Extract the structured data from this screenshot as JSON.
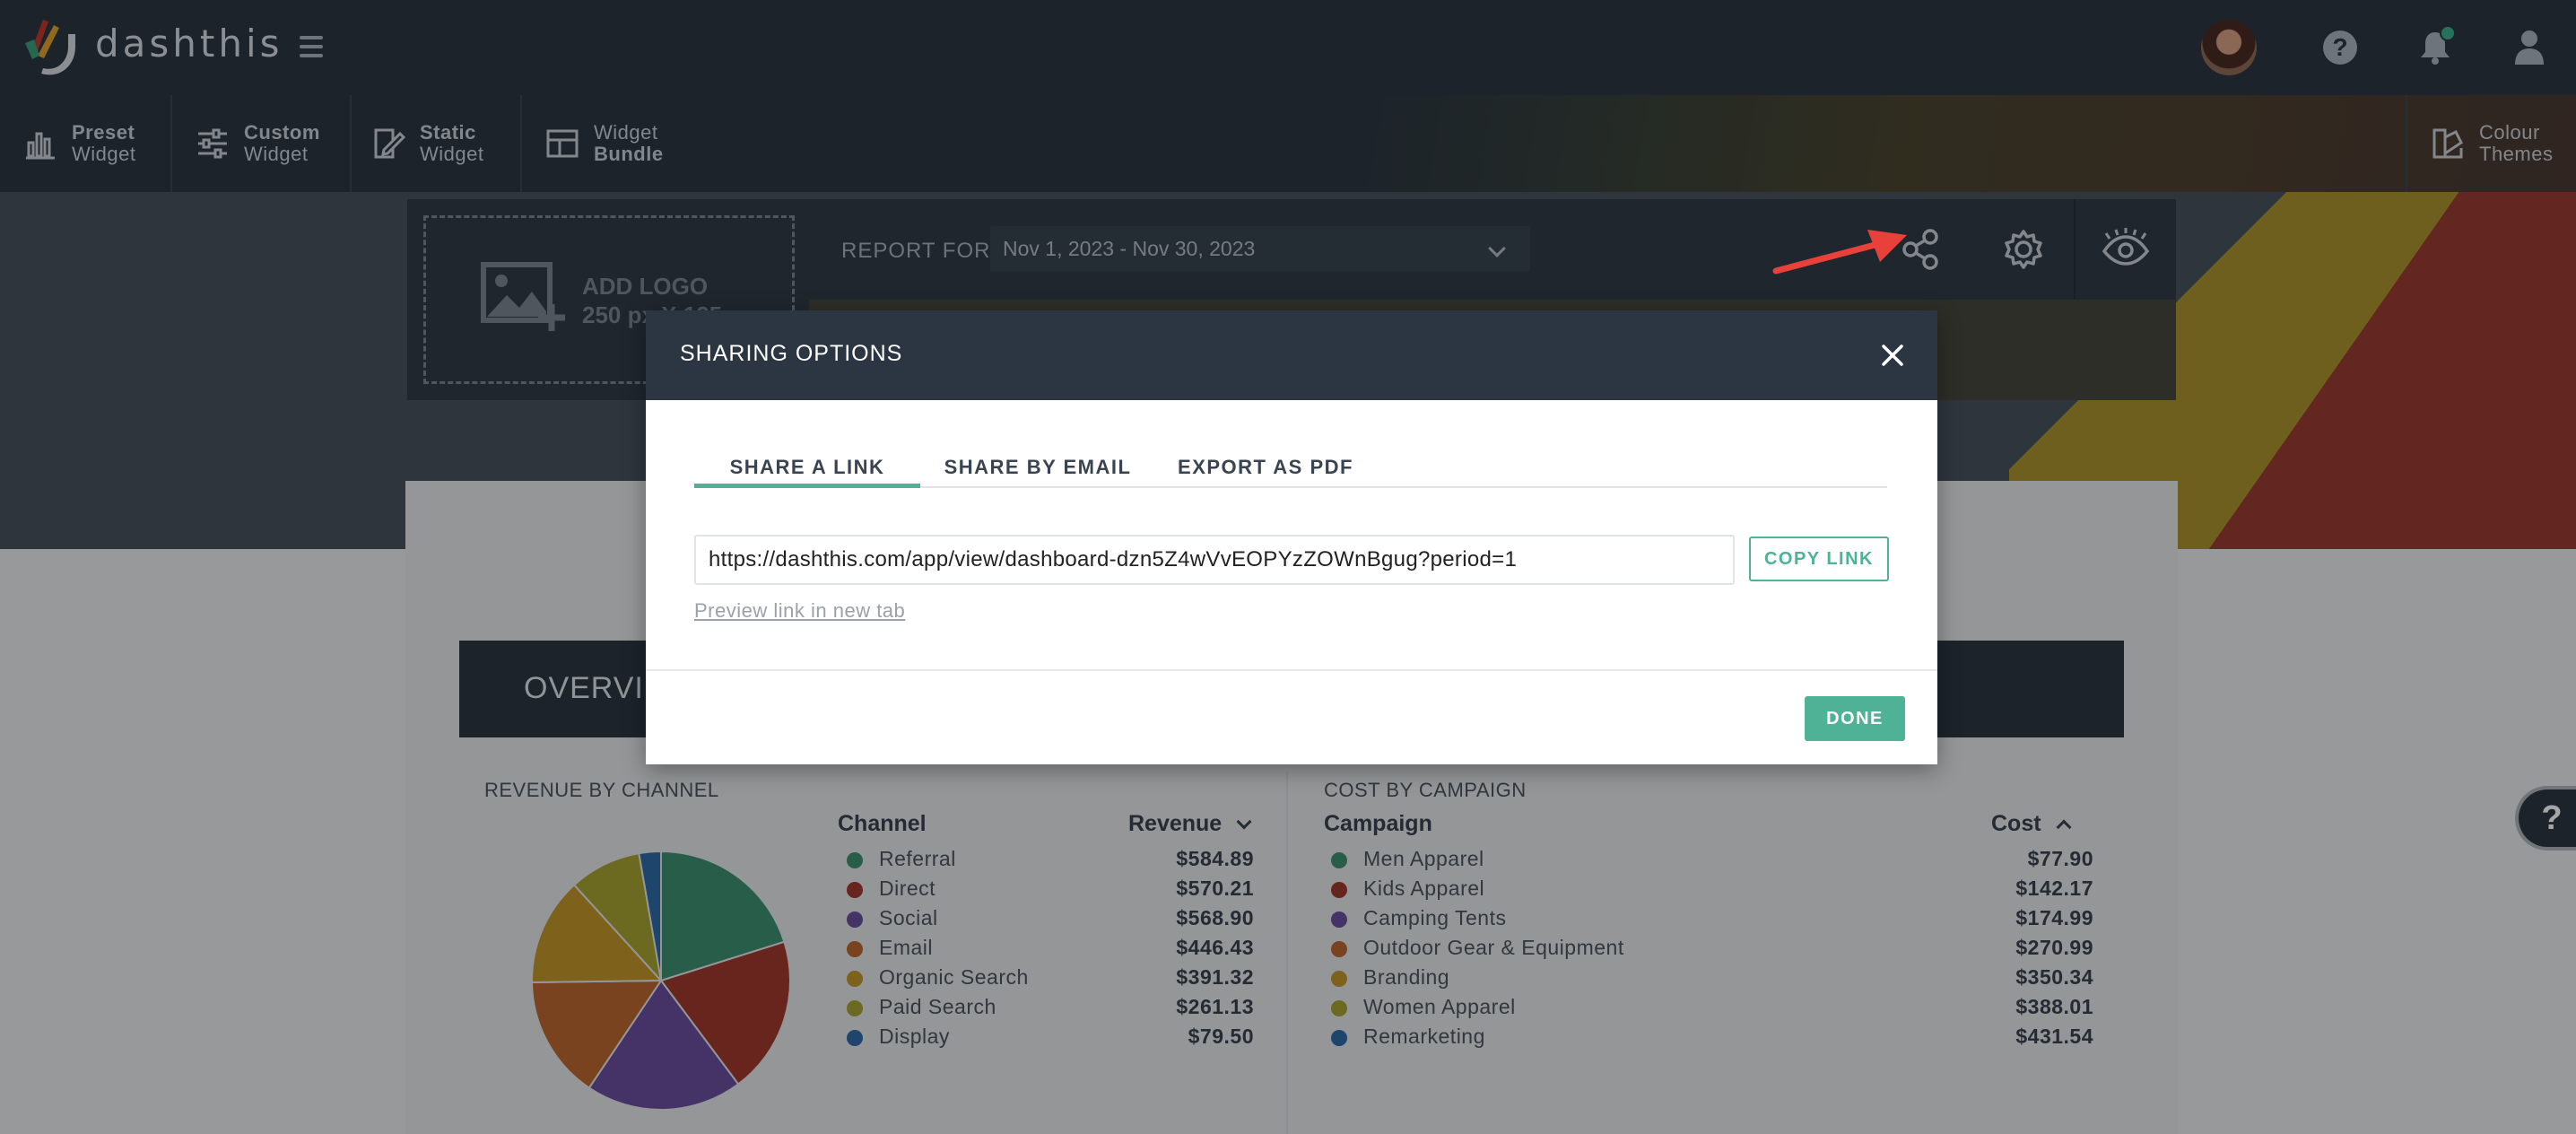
{
  "app": {
    "brand": "dashthis"
  },
  "toolbar": {
    "items": [
      {
        "line1": "Preset",
        "line2": "Widget",
        "icon": "bar-chart-icon"
      },
      {
        "line1": "Custom",
        "line2": "Widget",
        "icon": "sliders-icon"
      },
      {
        "line1": "Static",
        "line2": "Widget",
        "icon": "edit-icon"
      },
      {
        "line1": "Widget",
        "line2": "Bundle",
        "icon": "bundle-icon"
      }
    ],
    "colour_themes": {
      "line1": "Colour",
      "line2": "Themes",
      "icon": "palette-icon"
    }
  },
  "header": {
    "add_logo": {
      "line1": "ADD LOGO",
      "line2": "250 px X 125 px"
    },
    "report_for_label": "REPORT FOR",
    "date_range": "Nov 1, 2023 - Nov 30, 2023"
  },
  "overview": {
    "title": "OVERVIEW"
  },
  "revenue_by_channel": {
    "title": "REVENUE BY CHANNEL",
    "col_name": "Channel",
    "col_value": "Revenue",
    "rows": [
      {
        "name": "Referral",
        "value": "$584.89",
        "color": "#3e8f72"
      },
      {
        "name": "Direct",
        "value": "$570.21",
        "color": "#9e3a2f"
      },
      {
        "name": "Social",
        "value": "$568.90",
        "color": "#6b4fa0"
      },
      {
        "name": "Email",
        "value": "$446.43",
        "color": "#b8672e"
      },
      {
        "name": "Organic Search",
        "value": "$391.32",
        "color": "#c2972c"
      },
      {
        "name": "Paid Search",
        "value": "$261.13",
        "color": "#a6a334"
      },
      {
        "name": "Display",
        "value": "$79.50",
        "color": "#2f6aa5"
      }
    ]
  },
  "cost_by_campaign": {
    "title": "COST BY CAMPAIGN",
    "col_name": "Campaign",
    "col_value": "Cost",
    "rows": [
      {
        "name": "Men Apparel",
        "value": "$77.90",
        "color": "#3e8f72"
      },
      {
        "name": "Kids Apparel",
        "value": "$142.17",
        "color": "#9e3a2f"
      },
      {
        "name": "Camping Tents",
        "value": "$174.99",
        "color": "#6b4fa0"
      },
      {
        "name": "Outdoor Gear & Equipment",
        "value": "$270.99",
        "color": "#b8672e"
      },
      {
        "name": "Branding",
        "value": "$350.34",
        "color": "#c2972c"
      },
      {
        "name": "Women Apparel",
        "value": "$388.01",
        "color": "#a6a334"
      },
      {
        "name": "Remarketing",
        "value": "$431.54",
        "color": "#2f6aa5"
      }
    ]
  },
  "modal": {
    "title": "SHARING OPTIONS",
    "tabs": [
      "SHARE A LINK",
      "SHARE BY EMAIL",
      "EXPORT AS PDF"
    ],
    "active_tab": "SHARE A LINK",
    "link_value": "https://dashthis.com/app/view/dashboard-dzn5Z4wVvEOPYzZOWnBgug?period=1",
    "copy_label": "COPY LINK",
    "preview_label": "Preview link in new tab",
    "done_label": "DONE"
  },
  "help_bubble": "?",
  "colors": {
    "accent": "#4fb196",
    "header": "#2b3642",
    "annotation": "#e8413a"
  }
}
